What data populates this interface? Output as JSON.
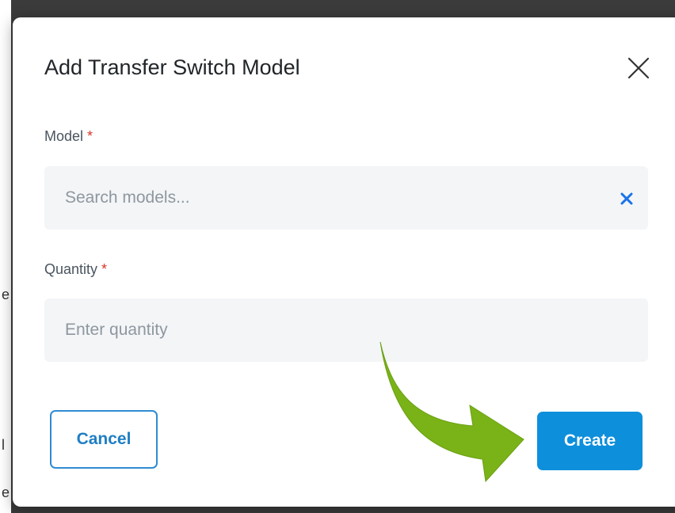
{
  "modal": {
    "title": "Add Transfer Switch Model",
    "close_icon": "close-icon"
  },
  "fields": {
    "model": {
      "label": "Model",
      "required_mark": "*",
      "placeholder": "Search models...",
      "clear_icon": "clear-x-icon"
    },
    "quantity": {
      "label": "Quantity",
      "required_mark": "*",
      "placeholder": "Enter quantity"
    }
  },
  "buttons": {
    "cancel_label": "Cancel",
    "create_label": "Create"
  },
  "annotation": {
    "arrow_icon": "curved-arrow-icon",
    "arrow_color": "#7ab317"
  },
  "colors": {
    "primary": "#0d8fdb",
    "required": "#d9342b",
    "clear_icon": "#1a73e8"
  }
}
